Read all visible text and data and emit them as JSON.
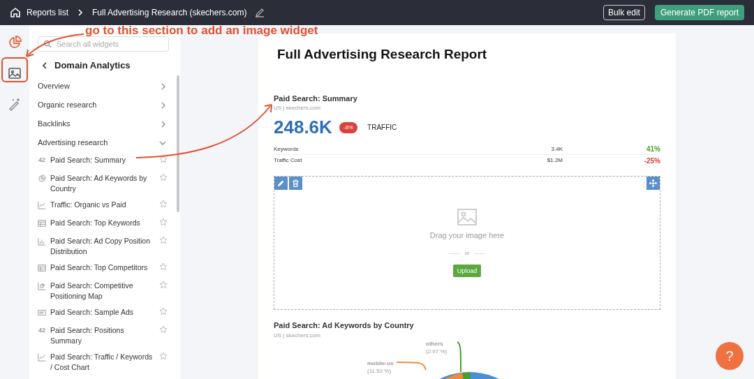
{
  "topbar": {
    "home_label": "Reports list",
    "title": "Full Advertising Research (skechers.com)",
    "buttons": [
      {
        "label": "Bulk edit",
        "kind": "outline"
      },
      {
        "label": "Generate PDF report",
        "kind": "primary"
      }
    ]
  },
  "rail": [
    {
      "kind": "chart"
    },
    {
      "kind": "image"
    },
    {
      "kind": "magic"
    }
  ],
  "sidebar": {
    "search_placeholder": "Search all widgets",
    "heading": "Domain Analytics",
    "categories": [
      {
        "label": "Overview",
        "expanded": false
      },
      {
        "label": "Organic research",
        "expanded": false
      },
      {
        "label": "Backlinks",
        "expanded": false
      },
      {
        "label": "Advertising research",
        "expanded": true,
        "children": [
          {
            "label": "Paid Search: Summary",
            "kind": "number",
            "badge": "42"
          },
          {
            "label": "Paid Search: Ad Keywords by Country",
            "kind": "pie"
          },
          {
            "label": "Traffic: Organic vs Paid",
            "kind": "line"
          },
          {
            "label": "Paid Search: Top Keywords",
            "kind": "table"
          },
          {
            "label": "Paid Search: Ad Copy Position Distribution",
            "kind": "bar"
          },
          {
            "label": "Paid Search: Top Competitors",
            "kind": "table"
          },
          {
            "label": "Paid Search: Competitive Positioning Map",
            "kind": "map"
          },
          {
            "label": "Paid Search: Sample Ads",
            "kind": "ad"
          },
          {
            "label": "Paid Search: Positions Summary",
            "kind": "number",
            "badge": "42"
          },
          {
            "label": "Paid Search: Traffic / Keywords / Cost Chart",
            "kind": "line"
          }
        ]
      }
    ]
  },
  "report": {
    "title": "Full Advertising Research Report",
    "summary": {
      "title": "Paid Search: Summary",
      "subtitle": "US | skechers.com",
      "value": "248.6K",
      "change": "-8%",
      "metric": "TRAFFIC",
      "rows": [
        {
          "label": "Keywords",
          "value": "3.4K",
          "change": "41%",
          "color": "#4aa02c"
        },
        {
          "label": "Traffic Cost",
          "value": "$1.2M",
          "change": "-25%",
          "color": "#d9423a"
        }
      ]
    },
    "image_widget": {
      "prompt": "Drag your image here",
      "separator": "or",
      "button": "Upload"
    },
    "country": {
      "title": "Paid Search: Ad Keywords by Country",
      "subtitle": "US | skechers.com",
      "labels": [
        {
          "name": "others",
          "share": "(2.97 %)",
          "color": "#4aa02c"
        },
        {
          "name": "mobile-us",
          "share": "(11.52 %)",
          "color": "#f08a3c"
        }
      ]
    }
  },
  "annotation": {
    "text": "go to this section to add an image widget"
  },
  "help_button": "?"
}
